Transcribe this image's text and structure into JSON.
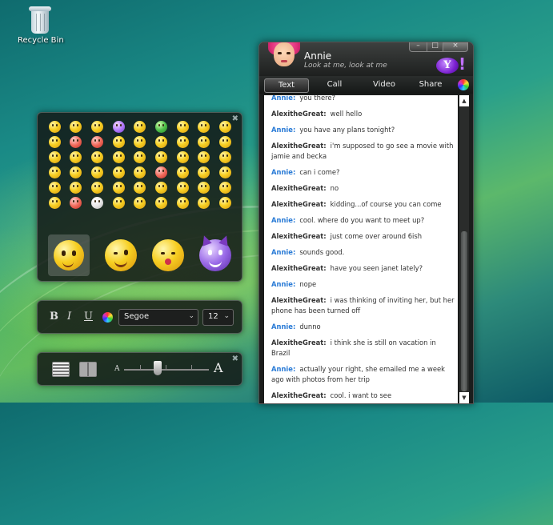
{
  "desktop": {
    "recycle_bin_label": "Recycle Bin"
  },
  "emoticons": {
    "grid_colors": [
      "y",
      "y",
      "y",
      "p",
      "y",
      "g",
      "y",
      "y",
      "y",
      "y",
      "r",
      "r",
      "y",
      "y",
      "y",
      "y",
      "y",
      "y",
      "y",
      "y",
      "y",
      "y",
      "y",
      "y",
      "y",
      "y",
      "y",
      "y",
      "y",
      "y",
      "y",
      "y",
      "r",
      "y",
      "y",
      "y",
      "y",
      "y",
      "y",
      "y",
      "y",
      "y",
      "y",
      "y",
      "y",
      "y",
      "r",
      "w",
      "y",
      "y",
      "y",
      "y",
      "y",
      "y"
    ],
    "large": [
      "thinking-face-emoticon",
      "winking-face-emoticon",
      "kissing-face-emoticon",
      "devil-emoticon"
    ],
    "close_glyph": "✖"
  },
  "format_bar": {
    "bold": "B",
    "italic": "I",
    "underline": "U",
    "font": "Segoe",
    "size": "12",
    "dropdown_arrow": "⌄"
  },
  "view_bar": {
    "small_a": "A",
    "large_a": "A",
    "close_glyph": "✖",
    "slider_level": 0.4
  },
  "chat": {
    "contact_name": "Annie",
    "contact_status": "Look at me, look at me",
    "window_buttons": {
      "minimize": "–",
      "maximize": "□",
      "close": "×"
    },
    "yahoo_logo": "Y",
    "yahoo_bang": "!",
    "tabs": [
      "Text",
      "Call",
      "Video",
      "Share"
    ],
    "active_tab": "Text",
    "messages": [
      {
        "sender": "Annie:",
        "text": "you there?"
      },
      {
        "sender": "AlexitheGreat:",
        "text": "well hello"
      },
      {
        "sender": "Annie:",
        "text": "you have any plans tonight?"
      },
      {
        "sender": "AlexitheGreat:",
        "text": "i'm supposed to go see a movie with jamie and becka"
      },
      {
        "sender": "Annie:",
        "text": "can i come?"
      },
      {
        "sender": "AlexitheGreat:",
        "text": "no"
      },
      {
        "sender": "AlexitheGreat:",
        "text": "kidding...of course you can come"
      },
      {
        "sender": "Annie:",
        "text": "cool. where do you want to meet up?"
      },
      {
        "sender": "AlexitheGreat:",
        "text": "just come over around 6ish"
      },
      {
        "sender": "Annie:",
        "text": "sounds good."
      },
      {
        "sender": "AlexitheGreat:",
        "text": "have you seen janet lately?"
      },
      {
        "sender": "Annie:",
        "text": "nope"
      },
      {
        "sender": "AlexitheGreat:",
        "text": "i was thinking of inviting her, but her phone has been turned off"
      },
      {
        "sender": "Annie:",
        "text": "dunno"
      },
      {
        "sender": "AlexitheGreat:",
        "text": "i think she is still on vacation in Brazil"
      },
      {
        "sender": "Annie:",
        "text": "actually your right, she emailed me a week ago with photos from her trip"
      },
      {
        "sender": "AlexitheGreat:",
        "text": "cool. i want to see"
      }
    ],
    "scroll_up": "▲",
    "scroll_down": "▼"
  }
}
